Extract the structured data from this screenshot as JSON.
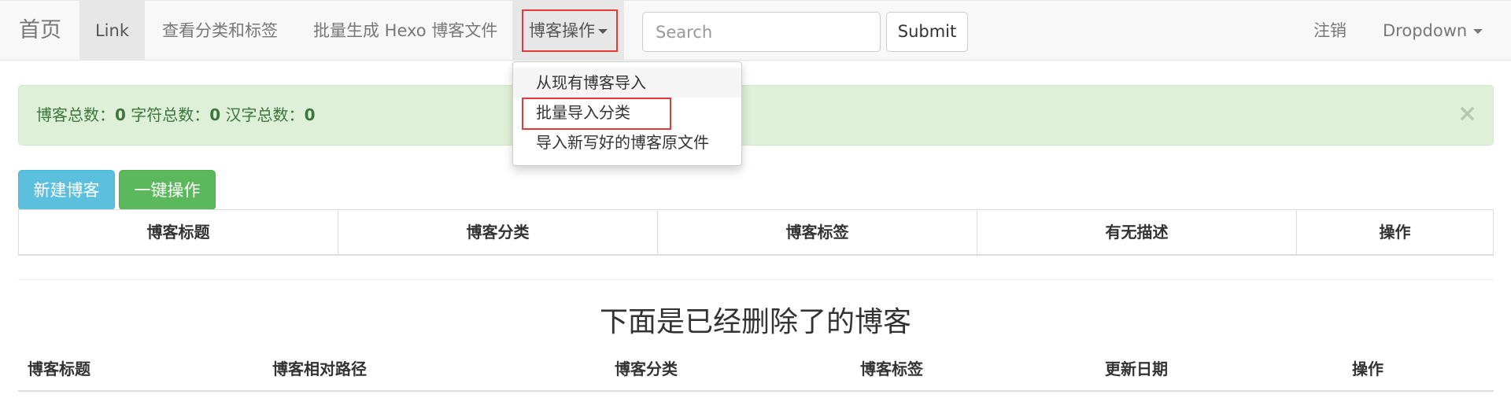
{
  "navbar": {
    "brand": "首页",
    "link": "Link",
    "view_categories": "查看分类和标签",
    "batch_generate": "批量生成 Hexo 博客文件",
    "blog_ops": "博客操作",
    "search_placeholder": "Search",
    "submit": "Submit",
    "logout": "注销",
    "dropdown": "Dropdown"
  },
  "dropdown_menu": {
    "items": [
      {
        "label": "从现有博客导入"
      },
      {
        "label": "批量导入分类"
      },
      {
        "label": "导入新写好的博客原文件"
      }
    ]
  },
  "alert": {
    "total_blogs_label": "博客总数：",
    "total_blogs": "0",
    "total_chars_label": " 字符总数：",
    "total_chars": "0",
    "total_hanzi_label": " 汉字总数：",
    "total_hanzi": "0",
    "close": "×"
  },
  "buttons": {
    "new_blog": "新建博客",
    "one_click": "一键操作"
  },
  "blog_table": {
    "headers": [
      "博客标题",
      "博客分类",
      "博客标签",
      "有无描述",
      "操作"
    ]
  },
  "deleted_section": {
    "title": "下面是已经删除了的博客",
    "headers": [
      "博客标题",
      "博客相对路径",
      "博客分类",
      "博客标签",
      "更新日期",
      "操作"
    ]
  },
  "colors": {
    "annotation_red": "#e53935",
    "alert_green_bg": "#dff0d8",
    "info_btn": "#5bc0de",
    "success_btn": "#5cb85c"
  }
}
